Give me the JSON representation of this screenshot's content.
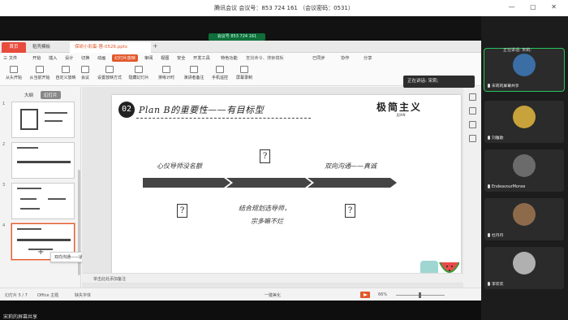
{
  "meeting": {
    "title": "腾讯会议 会议号：853 724 161  （会议密码：0531）",
    "share_pill": "会议号 853 724 161",
    "sharing_label": "宋莉的屏幕共享",
    "speaking_now": "正在讲话: 宋莉;",
    "window_controls": "—  ▢  ✕"
  },
  "wps": {
    "tabs": {
      "home": "首页",
      "template": "稻壳模板",
      "file": "保研小彩蛋-蓉-0526.pptx",
      "add": "+"
    },
    "menus": [
      "三 文件",
      "开始",
      "插入",
      "设计",
      "切换",
      "动画",
      "幻灯片放映",
      "审阅",
      "视图",
      "安全",
      "开发工具",
      "特色功能",
      "查找命令、搜索模板",
      "已同步",
      "协作",
      "分享"
    ],
    "active_menu_index": 6,
    "ribbon": [
      "从头开始",
      "从当前开始",
      "自定义放映",
      "会议",
      "设置放映方式",
      "隐藏幻灯片",
      "排练计时",
      "演讲者备注",
      "手机遥控",
      "屏幕录制"
    ],
    "panel": {
      "outline": "大纲",
      "slides": "幻灯片",
      "thumb_numbers": [
        "1",
        "2",
        "3",
        "4",
        "5"
      ],
      "tooltip": "双向沟通——适合自己...",
      "add": "+"
    },
    "slide": {
      "number": "02",
      "title": "Plan B的重要性——有目标型",
      "brand": "极简主义",
      "brand_sub": "JIJIAN",
      "left_label": "心仪导师没名额",
      "right_label": "双向沟通——真诚",
      "bottom_label_1": "结合规划选导师，",
      "bottom_label_2": "宗多嘛不烂",
      "q1": "?",
      "q2": "?",
      "q3": "?"
    },
    "notes": "单击此处添加备注",
    "status": {
      "slide": "幻灯片 5 / 7",
      "theme": "Office 主题",
      "font": "缺失字体",
      "beautify": "一键美化",
      "zoom": "66%"
    }
  },
  "participants": [
    {
      "name": "宋莉的屏幕共享",
      "active": true,
      "avatar_color": "#3a6ea5"
    },
    {
      "name": "刘雅歌",
      "active": false,
      "avatar_color": "#c8a23a"
    },
    {
      "name": "EndeavourMonse",
      "active": false,
      "avatar_color": "#6b6b6b"
    },
    {
      "name": "杜丹丹",
      "active": false,
      "avatar_color": "#8d6a4a"
    },
    {
      "name": "李欢欢",
      "active": false,
      "avatar_color": "#b0b0b0"
    }
  ],
  "colors": {
    "accent": "#e2572b",
    "active_speaker": "#27c35f"
  }
}
